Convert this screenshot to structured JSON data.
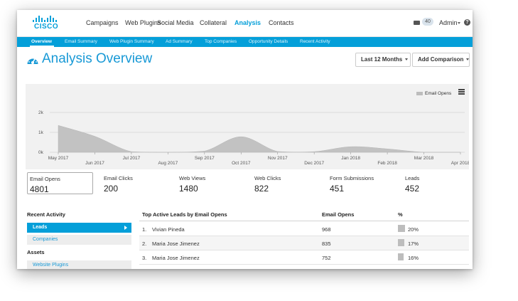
{
  "brand": {
    "logo_text": "CISCO",
    "accent": "#049fd9",
    "title_color": "#1899d6"
  },
  "topnav": {
    "items": [
      {
        "label": "Campaigns",
        "active": false
      },
      {
        "label": "Web Plugins",
        "active": false
      },
      {
        "label": "Social Media",
        "active": false
      },
      {
        "label": "Collateral",
        "active": false
      },
      {
        "label": "Analysis",
        "active": true
      },
      {
        "label": "Contacts",
        "active": false
      }
    ],
    "mail_icon": "envelope-icon",
    "badge_count": "40",
    "user": "Admin",
    "help_icon": "help-icon",
    "help_glyph": "?"
  },
  "subnav": {
    "items": [
      {
        "label": "Overview",
        "active": true
      },
      {
        "label": "Email Summary",
        "active": false
      },
      {
        "label": "Web Plugin Summary",
        "active": false
      },
      {
        "label": "Ad Summary",
        "active": false
      },
      {
        "label": "Top Companies",
        "active": false
      },
      {
        "label": "Opportunity Details",
        "active": false
      },
      {
        "label": "Recent Activity",
        "active": false
      }
    ]
  },
  "header": {
    "title": "Analysis Overview",
    "title_icon": "dashboard-gauge-icon",
    "range_button": "Last 12 Months",
    "comparison_button": "Add Comparison"
  },
  "chart_data": {
    "type": "area",
    "x": [
      "May 2017",
      "Jun 2017",
      "Jul 2017",
      "Aug 2017",
      "Sep 2017",
      "Oct 2017",
      "Nov 2017",
      "Dec 2017",
      "Jan 2018",
      "Feb 2018",
      "Mar 2018",
      "Apr 2018"
    ],
    "series": [
      {
        "name": "Email Opens",
        "values": [
          1350,
          800,
          30,
          0,
          60,
          780,
          40,
          30,
          280,
          170,
          0,
          0
        ]
      }
    ],
    "ylim": [
      0,
      2000
    ],
    "yticks": [
      "0k",
      "1k",
      "2k"
    ],
    "grid": true,
    "legend": "top-right",
    "series_color": "#c2c2c2",
    "menu_icon": "hamburger-menu-icon"
  },
  "stats": [
    {
      "label": "Email Opens",
      "value": "4801",
      "selected": true
    },
    {
      "label": "Email Clicks",
      "value": "200",
      "selected": false
    },
    {
      "label": "Web Views",
      "value": "1480",
      "selected": false
    },
    {
      "label": "Web Clicks",
      "value": "822",
      "selected": false
    },
    {
      "label": "Form Submissions",
      "value": "451",
      "selected": false
    },
    {
      "label": "Leads",
      "value": "452",
      "selected": false
    }
  ],
  "sidebar": {
    "recent_activity_heading": "Recent Activity",
    "recent_items": [
      {
        "label": "Leads",
        "active": true
      },
      {
        "label": "Companies",
        "active": false
      }
    ],
    "assets_heading": "Assets",
    "asset_items": [
      {
        "label": "Website Plugins"
      }
    ]
  },
  "table": {
    "title": "Top Active Leads by Email Opens",
    "col_opens": "Email Opens",
    "col_pct": "%",
    "rows": [
      {
        "rank": "1.",
        "name": "Vivian Pineda",
        "opens": "968",
        "pct": "20%",
        "share": 0.2
      },
      {
        "rank": "2.",
        "name": "Maria Jose Jimenez",
        "opens": "835",
        "pct": "17%",
        "share": 0.17
      },
      {
        "rank": "3.",
        "name": "Maria Jose Jimenez",
        "opens": "752",
        "pct": "16%",
        "share": 0.16
      }
    ]
  }
}
